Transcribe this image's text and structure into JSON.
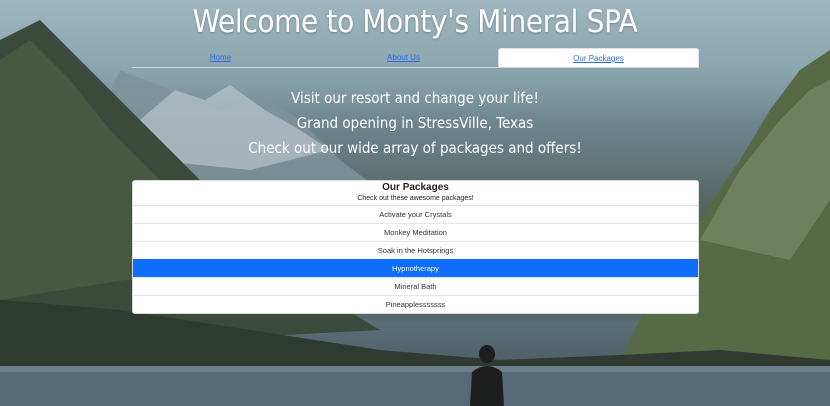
{
  "page": {
    "title": "Welcome to Monty's Mineral SPA"
  },
  "nav": {
    "tabs": [
      {
        "label": "Home",
        "active": false
      },
      {
        "label": "About Us",
        "active": false
      },
      {
        "label": "Our Packages",
        "active": true
      }
    ]
  },
  "hero": {
    "lines": [
      "Visit our resort and change your life!",
      "Grand opening in StressVille, Texas",
      "Check out our wide array of packages and offers!"
    ]
  },
  "packages": {
    "title": "Our Packages",
    "subtitle": "Check out these awesome packages!",
    "items": [
      {
        "label": "Activate your Crystals",
        "active": false
      },
      {
        "label": "Monkey Meditation",
        "active": false
      },
      {
        "label": "Soak in the Hotsprings",
        "active": false
      },
      {
        "label": "Hypnotherapy",
        "active": true
      },
      {
        "label": "Mineral Bath",
        "active": false
      },
      {
        "label": "Pineapplesssssss",
        "active": false
      }
    ]
  },
  "colors": {
    "accent": "#0d6efd",
    "link": "#2f6be6",
    "text_on_bg": "#ffffff"
  }
}
